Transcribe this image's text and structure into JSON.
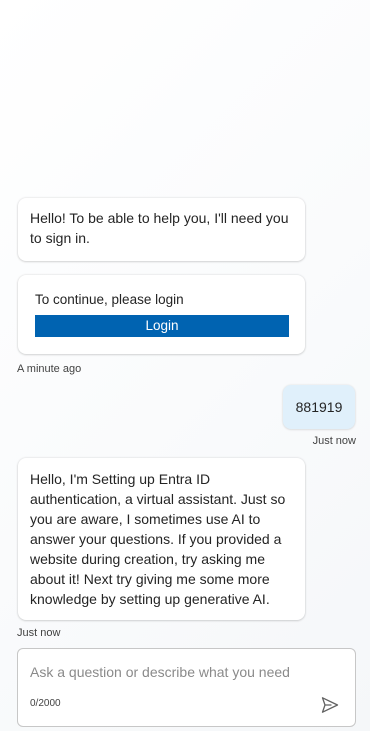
{
  "messages": {
    "greeting": "Hello! To be able to help you, I'll need you to sign in.",
    "login_card": {
      "prompt": "To continue, please login",
      "button_label": "Login",
      "button_color": "#0063b1"
    },
    "bot_timestamp_1": "A minute ago",
    "user_message": "881919",
    "user_timestamp": "Just now",
    "intro": "Hello, I'm Setting up Entra ID authentication, a virtual assistant. Just so you are aware, I sometimes use AI to answer your questions. If you provided a website during creation, try asking me about it! Next try giving me some more knowledge by setting up generative AI.",
    "bot_timestamp_2": "Just now"
  },
  "composer": {
    "placeholder": "Ask a question or describe what you need",
    "value": "",
    "char_count": "0/2000",
    "send_icon": "send-icon"
  }
}
